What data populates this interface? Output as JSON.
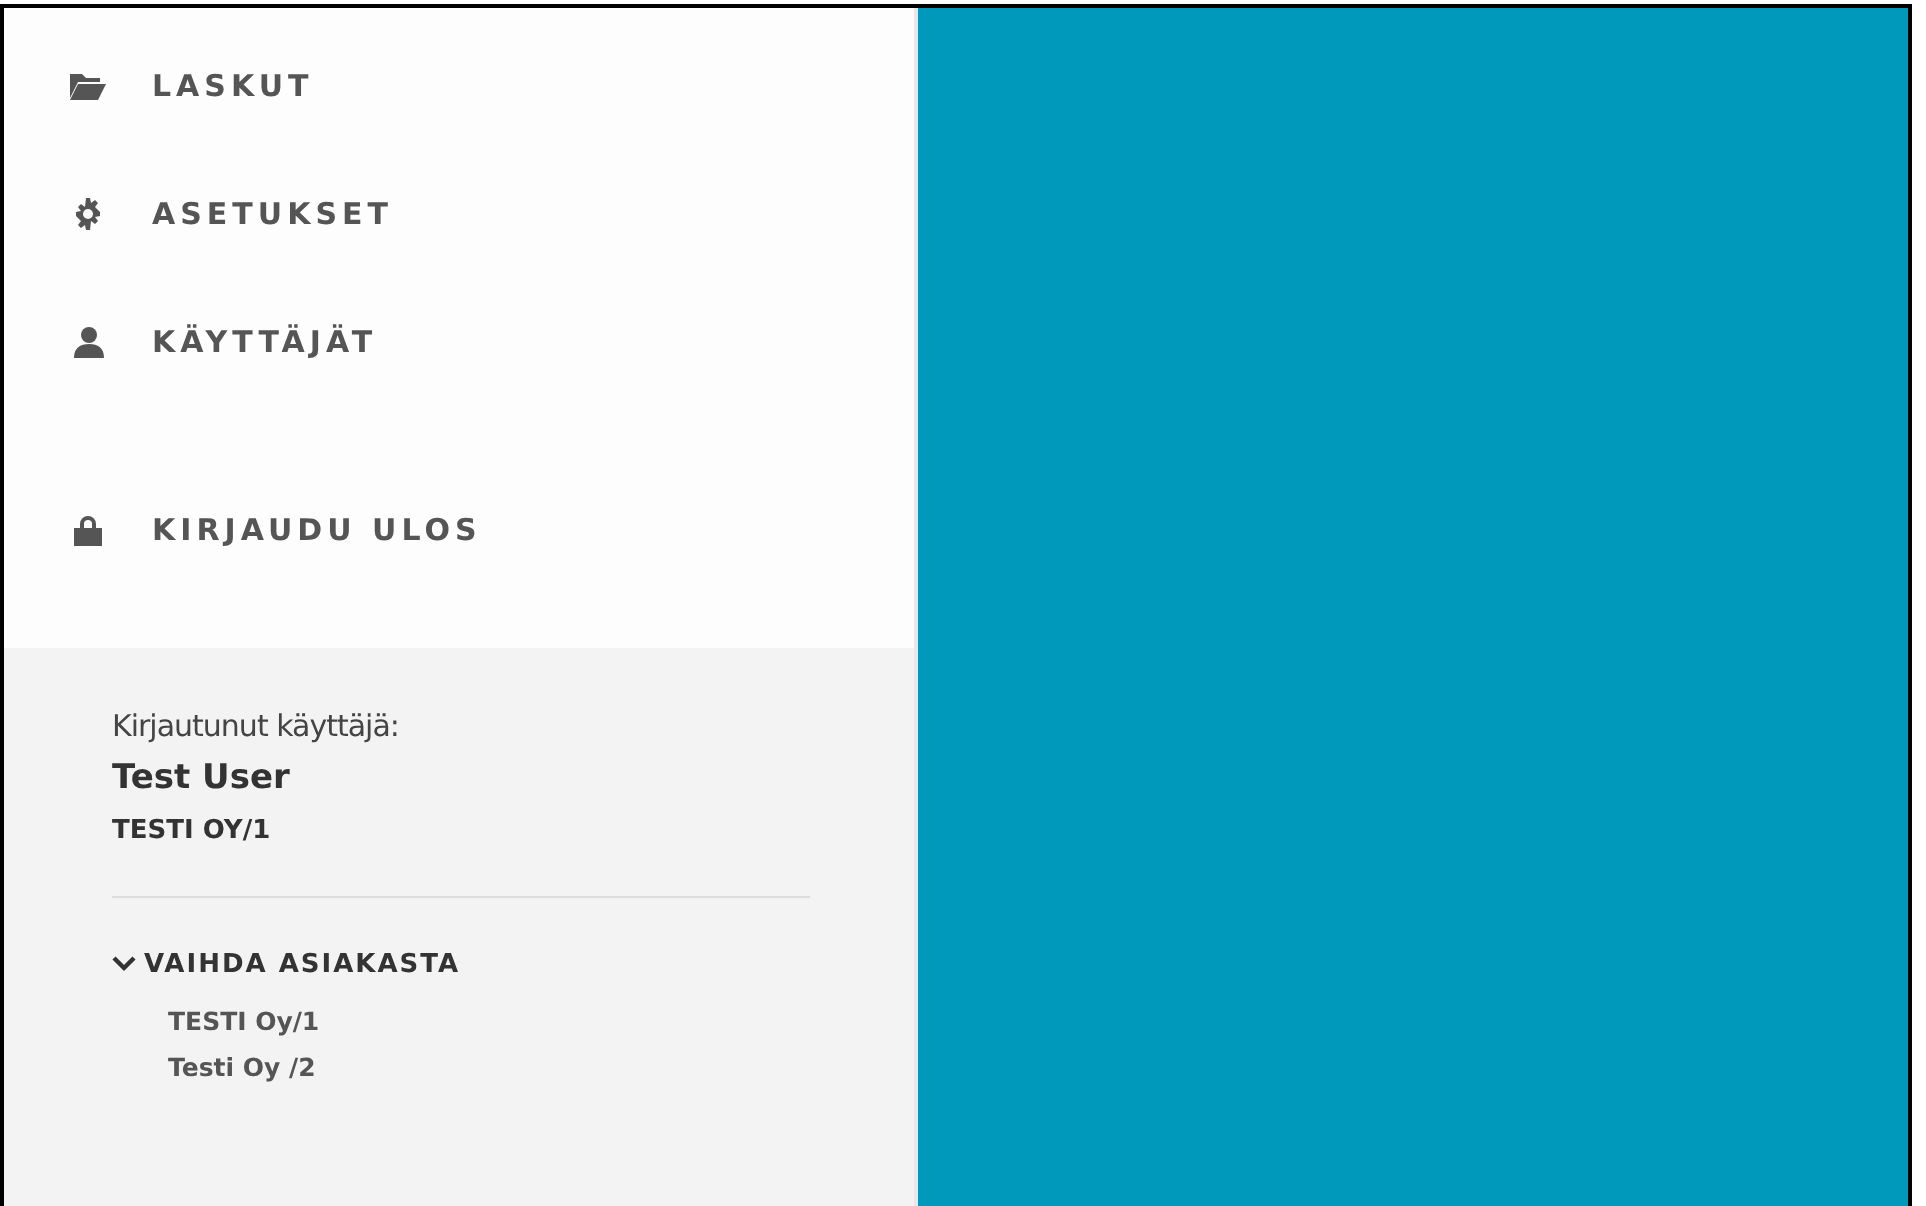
{
  "nav": [
    {
      "kind": "folder",
      "label": "LASKUT"
    },
    {
      "kind": "gear",
      "label": "ASETUKSET"
    },
    {
      "kind": "user",
      "label": "KÄYTTÄJÄT"
    },
    {
      "kind": "lock",
      "label": "KIRJAUDU ULOS"
    }
  ],
  "user_panel": {
    "caption": "Kirjautunut käyttäjä:",
    "name": "Test User",
    "company": "TESTI OY/1"
  },
  "switch_customer": {
    "label": "VAIHDA ASIAKASTA",
    "expanded": true,
    "items": [
      "TESTI Oy/1",
      "Testi Oy /2"
    ]
  }
}
